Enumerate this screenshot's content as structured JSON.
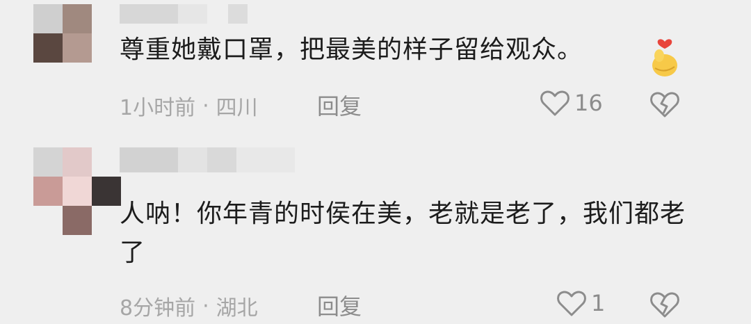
{
  "comments": [
    {
      "text": "尊重她戴口罩，把最美的样子留给观众。",
      "time": "1小时前",
      "location": "四川",
      "reply_label": "回复",
      "likes": "16",
      "emoji": "finger-heart-emoji"
    },
    {
      "text": "人呐！你年青的时侯在美，老就是老了，我们都老了",
      "time": "8分钟前",
      "location": "湖北",
      "reply_label": "回复",
      "likes": "1"
    }
  ],
  "meta_separator": "·",
  "icons": {
    "like": "heart-outline-icon",
    "dislike": "broken-heart-icon"
  },
  "colors": {
    "background": "#efefef",
    "text": "#1c1c1c",
    "meta": "#a6a6a6"
  }
}
